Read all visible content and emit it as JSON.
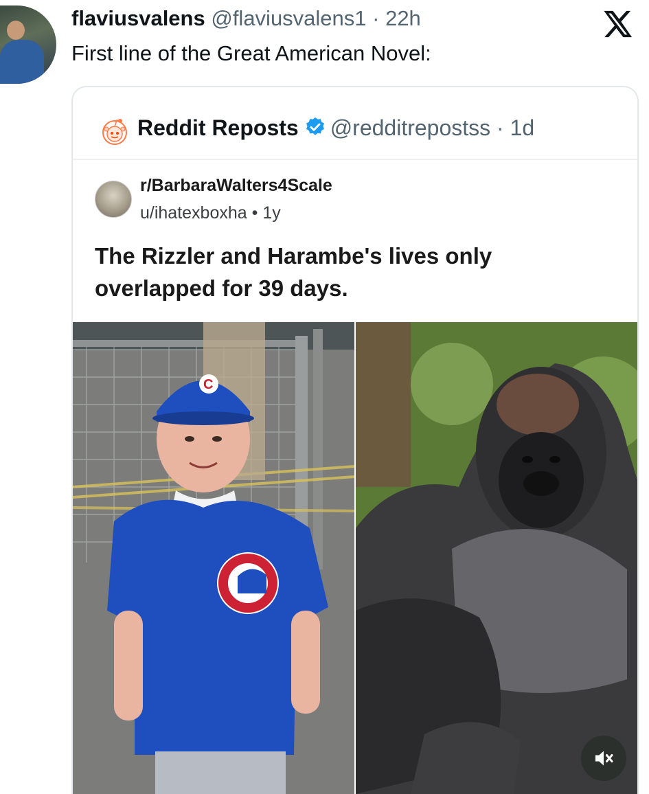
{
  "tweet": {
    "display_name": "flaviusvalens",
    "handle_time": "@flaviusvalens1 · 22h",
    "text": "First line of the Great American Novel:"
  },
  "quote": {
    "display_name": "Reddit Reposts",
    "handle_time": "@redditrepostss · 1d",
    "post": {
      "subreddit": "r/BarbaraWalters4Scale",
      "user_time": "u/ihatexboxha • 1y",
      "title": "The Rizzler and Harambe's lives only overlapped for 39 days."
    }
  },
  "icons": {
    "x_logo": "x-logo-icon",
    "reddit": "reddit-alien-icon",
    "verified": "verified-badge-icon",
    "mute": "muted-speaker-icon"
  },
  "colors": {
    "verified_blue": "#1d9bf0",
    "cubs_blue": "#1f4fbf",
    "cubs_red": "#cc2233"
  }
}
